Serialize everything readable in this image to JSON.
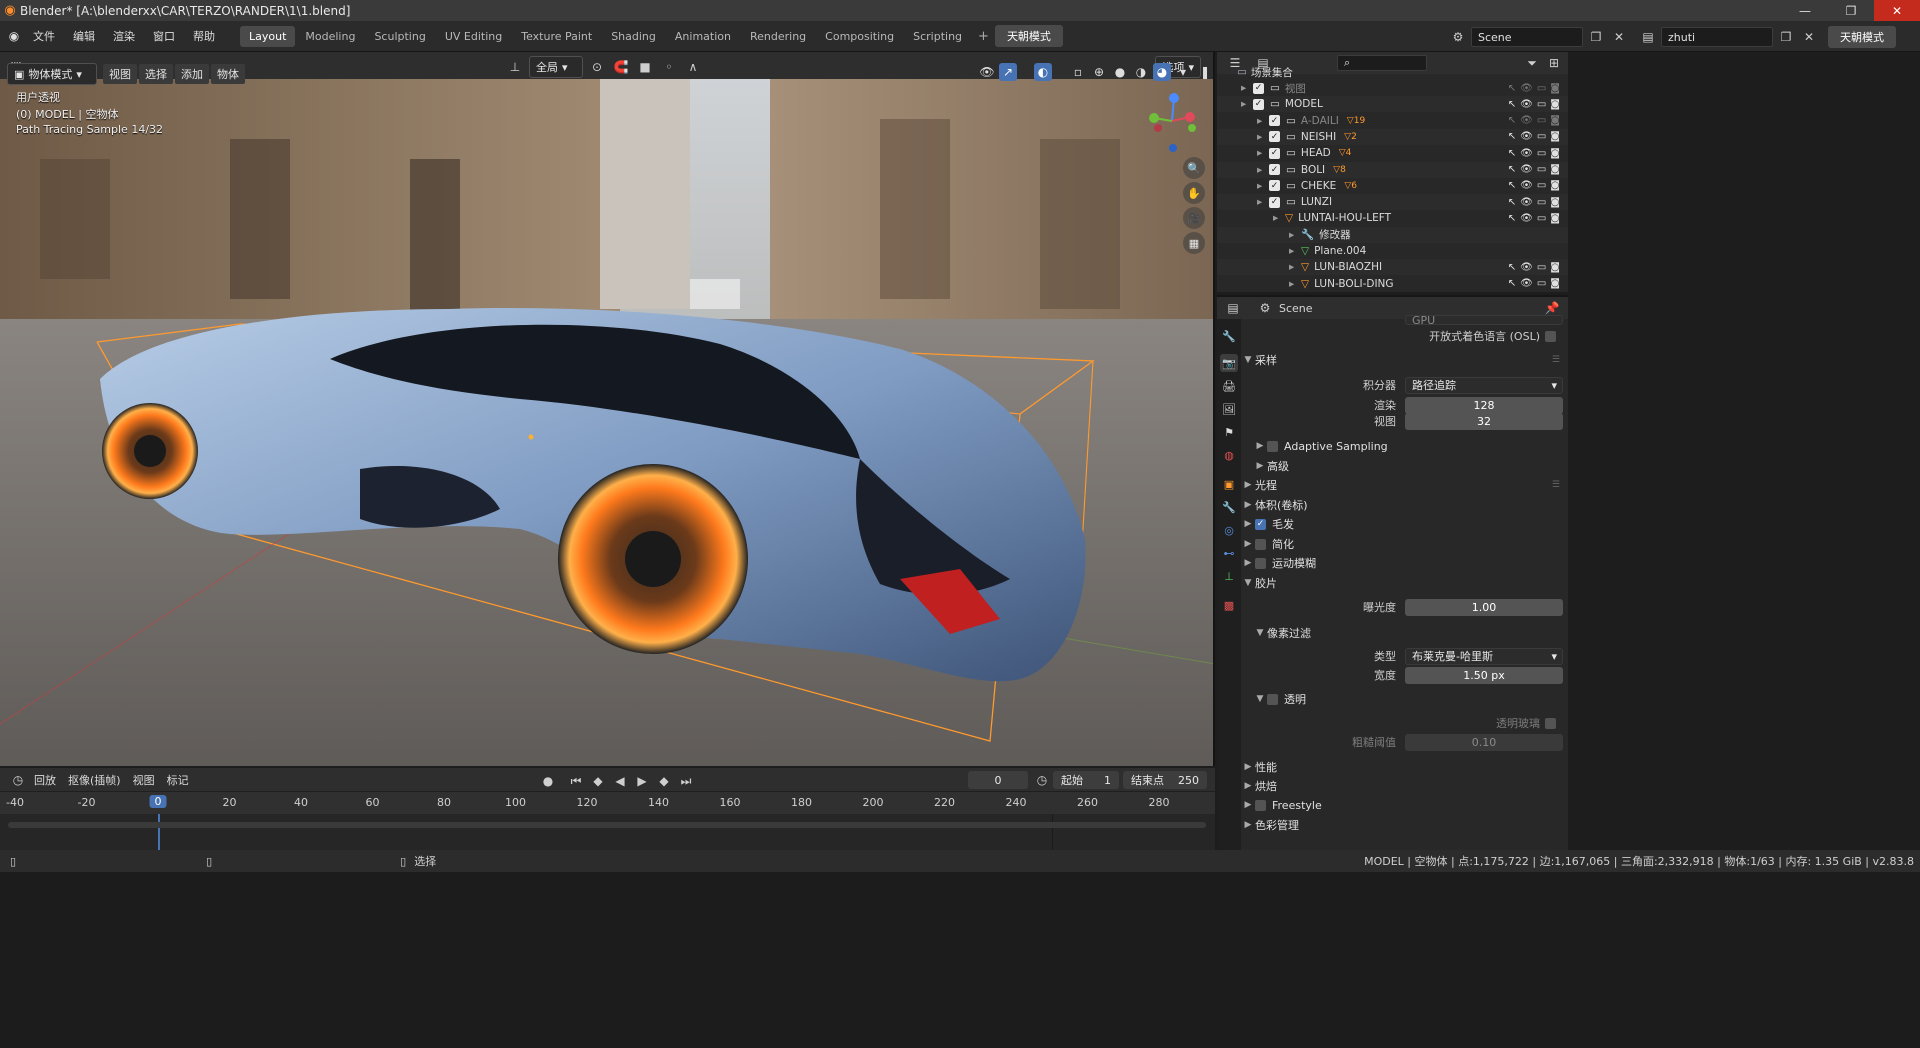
{
  "window": {
    "title": "Blender* [A:\\blenderxx\\CAR\\TERZO\\RANDER\\1\\1.blend]",
    "controls": [
      "—",
      "❐",
      "✕"
    ]
  },
  "topbar": {
    "menus": [
      "文件",
      "编辑",
      "渲染",
      "窗口",
      "帮助"
    ],
    "workspaces": [
      "Layout",
      "Modeling",
      "Sculpting",
      "UV Editing",
      "Texture Paint",
      "Shading",
      "Animation",
      "Rendering",
      "Compositing",
      "Scripting"
    ],
    "active_workspace": "Layout",
    "mode_badge": "天朝模式",
    "scene_label": "Scene",
    "view_layer_label": "zhuti",
    "right_badge": "天朝模式"
  },
  "viewport": {
    "mode": "物体模式",
    "menus": [
      "视图",
      "选择",
      "添加",
      "物体"
    ],
    "transform_orientation": "全局",
    "options_label": "选项",
    "overlay_lines": [
      "用户透视",
      "(0) MODEL | 空物体",
      "Path Tracing Sample 14/32"
    ]
  },
  "outliner": {
    "root": "场景集合",
    "rows": [
      {
        "name": "视图",
        "depth": 1,
        "checked": true,
        "dim": true,
        "type": "collection"
      },
      {
        "name": "MODEL",
        "depth": 1,
        "checked": true,
        "type": "collection"
      },
      {
        "name": "A-DAILI",
        "depth": 2,
        "checked": true,
        "dim": true,
        "type": "collection",
        "badge": "19"
      },
      {
        "name": "NEISHI",
        "depth": 2,
        "checked": true,
        "type": "collection",
        "badge": "2"
      },
      {
        "name": "HEAD",
        "depth": 2,
        "checked": true,
        "type": "collection",
        "badge": "4"
      },
      {
        "name": "BOLI",
        "depth": 2,
        "checked": true,
        "type": "collection",
        "badge": "8"
      },
      {
        "name": "CHEKE",
        "depth": 2,
        "checked": true,
        "type": "collection",
        "badge": "6"
      },
      {
        "name": "LUNZI",
        "depth": 2,
        "checked": true,
        "type": "collection"
      },
      {
        "name": "LUNTAI-HOU-LEFT",
        "depth": 3,
        "type": "object"
      },
      {
        "name": "修改器",
        "depth": 4,
        "type": "modifier"
      },
      {
        "name": "Plane.004",
        "depth": 4,
        "type": "mesh"
      },
      {
        "name": "LUN-BIAOZHI",
        "depth": 4,
        "type": "object"
      },
      {
        "name": "LUN-BOLI-DING",
        "depth": 4,
        "type": "object"
      }
    ]
  },
  "properties": {
    "header": "Scene",
    "partial_top_value": "GPU",
    "osl_label": "开放式着色语言 (OSL)",
    "sampling": {
      "title": "采样",
      "integrator_label": "积分器",
      "integrator_value": "路径追踪",
      "render_label": "渲染",
      "render_value": "128",
      "viewport_label": "视图",
      "viewport_value": "32",
      "adaptive": "Adaptive Sampling",
      "advanced": "高级"
    },
    "sections": {
      "light_paths": "光程",
      "volume": "体积(卷标)",
      "hair": "毛发",
      "simplify": "简化",
      "motion_blur": "运动模糊",
      "film": "胶片"
    },
    "film": {
      "exposure_label": "曝光度",
      "exposure_value": "1.00",
      "pixel_filter": "像素过滤",
      "type_label": "类型",
      "type_value": "布莱克曼-哈里斯",
      "width_label": "宽度",
      "width_value": "1.50 px",
      "transparent": "透明",
      "transparent_glass": "透明玻璃",
      "roughness_threshold": "粗糙阈值",
      "roughness_value": "0.10"
    },
    "bottom_sections": [
      "性能",
      "烘焙",
      "Freestyle",
      "色彩管理"
    ]
  },
  "timeline": {
    "menus": [
      "回放",
      "抠像(插帧)",
      "视图",
      "标记"
    ],
    "current_frame": "0",
    "start_label": "起始",
    "start_value": "1",
    "end_label": "结束点",
    "end_value": "250",
    "ticks": [
      "-40",
      "-20",
      "0",
      "20",
      "40",
      "60",
      "80",
      "100",
      "120",
      "140",
      "160",
      "180",
      "200",
      "220",
      "240",
      "260",
      "280"
    ]
  },
  "statusbar": {
    "left_hint": "选择",
    "stats": "MODEL | 空物体 | 点:1,175,722 | 边:1,167,065 | 三角面:2,332,918 | 物体:1/63 | 内存: 1.35 GiB | v2.83.8"
  }
}
